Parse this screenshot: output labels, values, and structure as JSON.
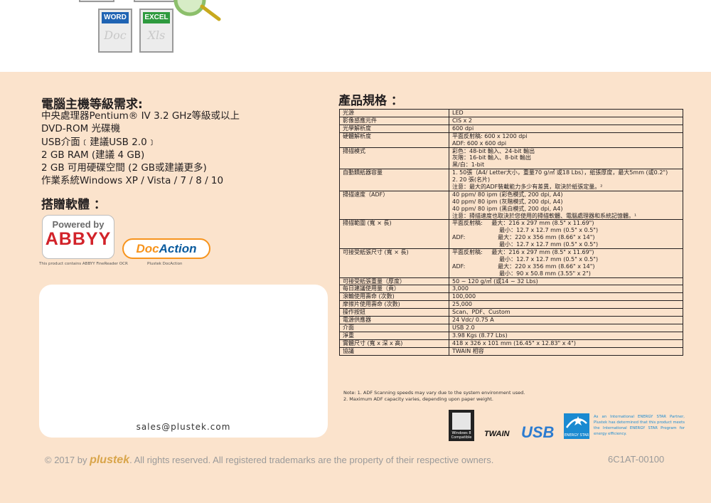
{
  "top_icons": {
    "word_badge": "WORD",
    "word_ghost": "Doc",
    "excel_badge": "EXCEL",
    "excel_ghost": "Xls",
    "colors": {
      "word": "#1f63b3",
      "excel": "#2e9a3e"
    }
  },
  "system_requirements": {
    "title": "電腦主機等級需求:",
    "items": [
      "中央處理器Pentium® IV 3.2 GHz等級或以上",
      "DVD-ROM 光碟機",
      "USB介面﹝建議USB 2.0﹞",
      "2 GB RAM (建議 4 GB)",
      "2 GB 可用硬碟空間 (2 GB或建議更多)",
      "作業系統Windows XP / Vista / 7 / 8 / 10"
    ]
  },
  "bundled_software": {
    "title": "搭贈軟體 ：",
    "abbyy_line1": "Powered by",
    "abbyy_line2": "ABBYY",
    "docaction_part1": "Doc",
    "docaction_part2": "Action",
    "abbyy_caption": "This product contains ABBYY FineReader OCR",
    "docaction_caption": "Plustek DocAction"
  },
  "contact": {
    "email": "sales@plustek.com"
  },
  "specifications": {
    "title": "產品規格 ：",
    "rows": [
      {
        "label": "光源",
        "lines": [
          "LED"
        ]
      },
      {
        "label": "影像感應元件",
        "lines": [
          "CIS x 2"
        ]
      },
      {
        "label": "光學解析度",
        "lines": [
          "600 dpi"
        ]
      },
      {
        "label": "硬體解析度",
        "lines": [
          "平面反射稿: 600 x 1200 dpi",
          "ADF: 600 x 600 dpi"
        ]
      },
      {
        "label": "掃描模式",
        "lines": [
          "彩色：48-bit 輸入、24-bit 輸出",
          "灰階：16-bit 輸入、8-bit 輸出",
          "黑/白：1-bit"
        ]
      },
      {
        "label": "自動饋紙器容量",
        "lines": [
          "1. 50張（A4/ Letter大小，重量70 g/㎡ 或18 Lbs），紙張厚度，最大5mm (或0.2\")",
          "2. 20 張(名片)",
          "注意：最大的ADF裝載能力多少有差異，取決於紙張定量。²"
        ]
      },
      {
        "label": "掃描速度（ADF）",
        "lines": [
          "40 ppm/ 80 ipm (彩色模式, 200 dpi, A4)",
          "40 ppm/ 80 ipm (灰階模式, 200 dpi, A4)",
          "40 ppm/ 80 ipm (黑白模式, 200 dpi, A4)",
          "注意：掃描速度也取決於您使用的掃描軟體、電腦處理器和系統記憶體。¹"
        ]
      },
      {
        "label": "掃描範圍 (寬 × 長)",
        "lines": [
          "平面反射稿:     最大：216 x 297 mm (8.5\" x 11.69\")",
          "                          最小：12.7 x 12.7 mm (0.5\" x 0.5\")",
          "ADF:                  最大：220 x 356 mm (8.66\" x 14\")",
          "                          最小：12.7 x 12.7 mm (0.5\" x 0.5\")"
        ]
      },
      {
        "label": "可接受紙張尺寸 (寬 × 長)",
        "lines": [
          "平面反射稿:     最大：216 x 297 mm (8.5\" x 11.69\")",
          "                          最小：12.7 x 12.7 mm (0.5\" x 0.5\")",
          "ADF:                  最大：220 x 356 mm (8.66\" x 14\")",
          "                          最小：90 x 50.8 mm (3.55\" x 2\")"
        ]
      },
      {
        "label": "可接受紙張重量（厚度）",
        "lines": [
          "50 ~ 120 g/㎡ (或14 ~ 32 Lbs)"
        ]
      },
      {
        "label": "每日建議使用量（頁）",
        "lines": [
          "3,000"
        ]
      },
      {
        "label": "滾輪使用壽命 (次數)",
        "lines": [
          "100,000"
        ]
      },
      {
        "label": "摩擦片使用壽命 (次數)",
        "lines": [
          "25,000"
        ]
      },
      {
        "label": "操作按鈕",
        "lines": [
          "Scan、PDF、Custom"
        ]
      },
      {
        "label": "電源供應器",
        "lines": [
          "24 Vdc/ 0.75 A"
        ]
      },
      {
        "label": "介面",
        "lines": [
          "USB 2.0"
        ]
      },
      {
        "label": "淨重",
        "lines": [
          "3.98 Kgs (8.77 Lbs)"
        ]
      },
      {
        "label": "實體尺寸 (寬 x 深 x 高)",
        "lines": [
          "418 x 326 x 101 mm (16.45\" x 12.83\" x 4\")"
        ]
      },
      {
        "label": "協議",
        "lines": [
          "TWAIN 相容"
        ]
      }
    ],
    "notes": [
      "Note: 1. ADF Scanning speeds may vary due to the system environment used.",
      "          2. Maximum ADF capacity varies, depending upon paper weight."
    ]
  },
  "logos": {
    "windows_caption": "Windows 8 Compatible",
    "twain": "TWAIN",
    "usb": "USB",
    "energy_star_caption": "ENERGY STAR",
    "energy_star_text": "As an International ENERGY STAR Partner, Plustek has determined that this product meets the International ENERGY STAR Program for energy efficiency."
  },
  "footer": {
    "prefix": "© 2017 by ",
    "brand": "plustek",
    "suffix": ". All rights reserved. All registered trademarks are the property of their respective owners.",
    "code": "6C1AT-00100"
  }
}
